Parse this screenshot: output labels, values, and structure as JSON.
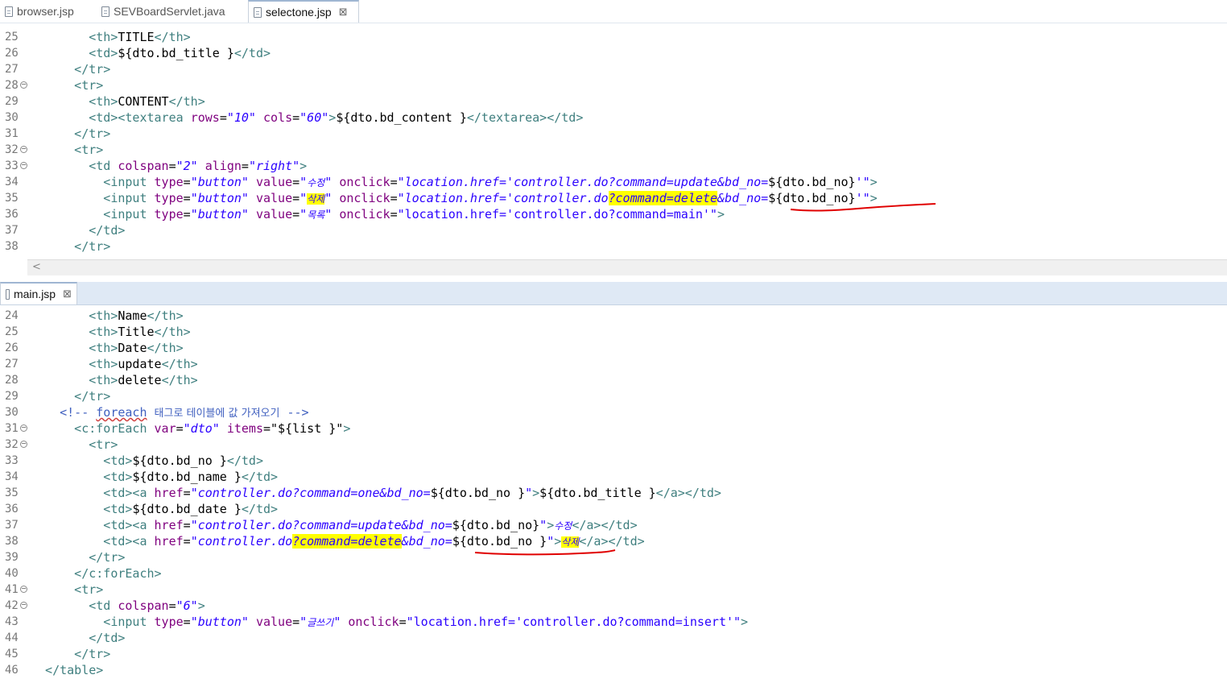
{
  "top_tabs": [
    {
      "label": "browser.jsp"
    },
    {
      "label": "SEVBoardServlet.java"
    },
    {
      "label": "selectone.jsp",
      "active": true
    }
  ],
  "bottom_tabs": [
    {
      "label": "main.jsp",
      "active": true
    }
  ],
  "close_glyph": "⊠",
  "scroll_left_glyph": "<",
  "colors": {
    "highlight": "#ffff00",
    "annotation": "#e00000",
    "tag": "#3f7f7f",
    "attr_name": "#7f007f",
    "attr_value": "#2a00ff"
  },
  "editor1": {
    "lines": [
      {
        "n": "25",
        "s": [
          [
            "tg",
            "        <th>"
          ],
          [
            "tx",
            "TITLE"
          ],
          [
            "tg",
            "</th>"
          ]
        ]
      },
      {
        "n": "26",
        "s": [
          [
            "tg",
            "        <td>"
          ],
          [
            "tx",
            "${dto.bd_title }"
          ],
          [
            "tg",
            "</td>"
          ]
        ]
      },
      {
        "n": "27",
        "s": [
          [
            "tg",
            "      </tr>"
          ]
        ]
      },
      {
        "n": "28",
        "fold": true,
        "s": [
          [
            "tg",
            "      <tr>"
          ]
        ]
      },
      {
        "n": "29",
        "s": [
          [
            "tg",
            "        <th>"
          ],
          [
            "tx",
            "CONTENT"
          ],
          [
            "tg",
            "</th>"
          ]
        ]
      },
      {
        "n": "30",
        "s": [
          [
            "tg",
            "        <td><textarea "
          ],
          [
            "an",
            "rows"
          ],
          [
            "tx",
            "="
          ],
          [
            "av",
            "\"10\""
          ],
          [
            "tx",
            " "
          ],
          [
            "an",
            "cols"
          ],
          [
            "tx",
            "="
          ],
          [
            "av",
            "\"60\""
          ],
          [
            "tg",
            ">"
          ],
          [
            "tx",
            "${dto.bd_content }"
          ],
          [
            "tg",
            "</textarea></td>"
          ]
        ]
      },
      {
        "n": "31",
        "s": [
          [
            "tg",
            "      </tr>"
          ]
        ]
      },
      {
        "n": "32",
        "fold": true,
        "s": [
          [
            "tg",
            "      <tr>"
          ]
        ]
      },
      {
        "n": "33",
        "fold": true,
        "s": [
          [
            "tg",
            "        <td "
          ],
          [
            "an",
            "colspan"
          ],
          [
            "tx",
            "="
          ],
          [
            "av",
            "\"2\""
          ],
          [
            "tx",
            " "
          ],
          [
            "an",
            "align"
          ],
          [
            "tx",
            "="
          ],
          [
            "av",
            "\"right\""
          ],
          [
            "tg",
            ">"
          ]
        ]
      },
      {
        "n": "34",
        "s": [
          [
            "tg",
            "          <input "
          ],
          [
            "an",
            "type"
          ],
          [
            "tx",
            "="
          ],
          [
            "av",
            "\"button\""
          ],
          [
            "tx",
            " "
          ],
          [
            "an",
            "value"
          ],
          [
            "tx",
            "="
          ],
          [
            "av",
            "\""
          ],
          [
            "ko",
            "수정"
          ],
          [
            "av",
            "\""
          ],
          [
            "tx",
            " "
          ],
          [
            "an",
            "onclick"
          ],
          [
            "tx",
            "="
          ],
          [
            "av",
            "\"location.href='controller.do?command=update&bd_no="
          ],
          [
            "tx",
            "${dto.bd_no}"
          ],
          [
            "av",
            "'\""
          ],
          [
            "tg",
            ">"
          ]
        ]
      },
      {
        "n": "35",
        "s": [
          [
            "tg",
            "          <input "
          ],
          [
            "an",
            "type"
          ],
          [
            "tx",
            "="
          ],
          [
            "av",
            "\"button\""
          ],
          [
            "tx",
            " "
          ],
          [
            "an",
            "value"
          ],
          [
            "tx",
            "="
          ],
          [
            "av",
            "\""
          ],
          [
            "kohl",
            "삭제"
          ],
          [
            "av",
            "\""
          ],
          [
            "tx",
            " "
          ],
          [
            "an",
            "onclick"
          ],
          [
            "tx",
            "="
          ],
          [
            "av",
            "\"location.href='controller.do"
          ],
          [
            "avhl",
            "?command=delet"
          ],
          [
            "avhl2",
            "e"
          ],
          [
            "av",
            "&bd_no="
          ],
          [
            "tx",
            "${dto.bd_no}"
          ],
          [
            "av",
            "'\""
          ],
          [
            "tg",
            ">"
          ]
        ]
      },
      {
        "n": "36",
        "s": [
          [
            "tg",
            "          <input "
          ],
          [
            "an",
            "type"
          ],
          [
            "tx",
            "="
          ],
          [
            "av",
            "\"button\""
          ],
          [
            "tx",
            " "
          ],
          [
            "an",
            "value"
          ],
          [
            "tx",
            "="
          ],
          [
            "av",
            "\""
          ],
          [
            "ko",
            "목록"
          ],
          [
            "av",
            "\""
          ],
          [
            "tx",
            " "
          ],
          [
            "an",
            "onclick"
          ],
          [
            "tx",
            "="
          ],
          [
            "avn",
            "\"location.href='controller.do?command=main'\""
          ],
          [
            "tg",
            ">"
          ]
        ]
      },
      {
        "n": "37",
        "s": [
          [
            "tg",
            "        </td>"
          ]
        ]
      },
      {
        "n": "38",
        "s": [
          [
            "tg",
            "      </tr>"
          ]
        ]
      }
    ]
  },
  "editor2": {
    "lines": [
      {
        "n": "24",
        "s": [
          [
            "tg",
            "        <th>"
          ],
          [
            "tx",
            "Name"
          ],
          [
            "tg",
            "</th>"
          ]
        ]
      },
      {
        "n": "25",
        "s": [
          [
            "tg",
            "        <th>"
          ],
          [
            "tx",
            "Title"
          ],
          [
            "tg",
            "</th>"
          ]
        ]
      },
      {
        "n": "26",
        "s": [
          [
            "tg",
            "        <th>"
          ],
          [
            "tx",
            "Date"
          ],
          [
            "tg",
            "</th>"
          ]
        ]
      },
      {
        "n": "27",
        "s": [
          [
            "tg",
            "        <th>"
          ],
          [
            "tx",
            "update"
          ],
          [
            "tg",
            "</th>"
          ]
        ]
      },
      {
        "n": "28",
        "s": [
          [
            "tg",
            "        <th>"
          ],
          [
            "tx",
            "delete"
          ],
          [
            "tg",
            "</th>"
          ]
        ]
      },
      {
        "n": "29",
        "s": [
          [
            "tg",
            "      </tr>"
          ]
        ]
      },
      {
        "n": "30",
        "s": [
          [
            "cm",
            "    <!-- "
          ],
          [
            "cmsq",
            "foreach"
          ],
          [
            "cm",
            " "
          ],
          [
            "cmk",
            "태그로 테이블에 값 가져오기"
          ],
          [
            "cm",
            " -->"
          ]
        ]
      },
      {
        "n": "31",
        "fold": true,
        "s": [
          [
            "tg",
            "      <c:forEach "
          ],
          [
            "an",
            "var"
          ],
          [
            "tx",
            "="
          ],
          [
            "av",
            "\"dto\""
          ],
          [
            "tx",
            " "
          ],
          [
            "an",
            "items"
          ],
          [
            "tx",
            "="
          ],
          [
            "tx",
            "\"${list }\""
          ],
          [
            "tg",
            ">"
          ]
        ]
      },
      {
        "n": "32",
        "fold": true,
        "s": [
          [
            "tg",
            "        <tr>"
          ]
        ]
      },
      {
        "n": "33",
        "s": [
          [
            "tg",
            "          <td>"
          ],
          [
            "tx",
            "${dto.bd_no }"
          ],
          [
            "tg",
            "</td>"
          ]
        ]
      },
      {
        "n": "34",
        "s": [
          [
            "tg",
            "          <td>"
          ],
          [
            "tx",
            "${dto.bd_name }"
          ],
          [
            "tg",
            "</td>"
          ]
        ]
      },
      {
        "n": "35",
        "s": [
          [
            "tg",
            "          <td><a "
          ],
          [
            "an",
            "href"
          ],
          [
            "tx",
            "="
          ],
          [
            "av",
            "\"controller.do?command=one&bd_no="
          ],
          [
            "tx",
            "${dto.bd_no }"
          ],
          [
            "av",
            "\""
          ],
          [
            "tg",
            ">"
          ],
          [
            "tx",
            "${dto.bd_title }"
          ],
          [
            "tg",
            "</a></td>"
          ]
        ]
      },
      {
        "n": "36",
        "s": [
          [
            "tg",
            "          <td>"
          ],
          [
            "tx",
            "${dto.bd_date }"
          ],
          [
            "tg",
            "</td>"
          ]
        ]
      },
      {
        "n": "37",
        "s": [
          [
            "tg",
            "          <td><a "
          ],
          [
            "an",
            "href"
          ],
          [
            "tx",
            "="
          ],
          [
            "av",
            "\"controller.do?command=update&bd_no="
          ],
          [
            "tx",
            "${dto.bd_no}"
          ],
          [
            "av",
            "\""
          ],
          [
            "tg",
            ">"
          ],
          [
            "ko",
            "수정"
          ],
          [
            "tg",
            "</a></td>"
          ]
        ]
      },
      {
        "n": "38",
        "s": [
          [
            "tg",
            "          <td><a "
          ],
          [
            "an",
            "href"
          ],
          [
            "tx",
            "="
          ],
          [
            "av",
            "\"controller.do"
          ],
          [
            "avhl",
            "?command=delete"
          ],
          [
            "av",
            "&bd_no="
          ],
          [
            "tx",
            "${dto.bd_no }"
          ],
          [
            "av",
            "\""
          ],
          [
            "tg",
            ">"
          ],
          [
            "kohl",
            "삭제"
          ],
          [
            "tg",
            "</a></td>"
          ]
        ]
      },
      {
        "n": "39",
        "s": [
          [
            "tg",
            "        </tr>"
          ]
        ]
      },
      {
        "n": "40",
        "s": [
          [
            "tg",
            "      </c:forEach>"
          ]
        ]
      },
      {
        "n": "41",
        "fold": true,
        "s": [
          [
            "tg",
            "      <tr>"
          ]
        ]
      },
      {
        "n": "42",
        "fold": true,
        "s": [
          [
            "tg",
            "        <td "
          ],
          [
            "an",
            "colspan"
          ],
          [
            "tx",
            "="
          ],
          [
            "av",
            "\"6\""
          ],
          [
            "tg",
            ">"
          ]
        ]
      },
      {
        "n": "43",
        "s": [
          [
            "tg",
            "          <input "
          ],
          [
            "an",
            "type"
          ],
          [
            "tx",
            "="
          ],
          [
            "av",
            "\"button\""
          ],
          [
            "tx",
            " "
          ],
          [
            "an",
            "value"
          ],
          [
            "tx",
            "="
          ],
          [
            "av",
            "\""
          ],
          [
            "ko",
            "글쓰기"
          ],
          [
            "av",
            "\""
          ],
          [
            "tx",
            " "
          ],
          [
            "an",
            "onclick"
          ],
          [
            "tx",
            "="
          ],
          [
            "avn",
            "\"location.href='controller.do?command=insert'\""
          ],
          [
            "tg",
            ">"
          ]
        ]
      },
      {
        "n": "44",
        "s": [
          [
            "tg",
            "        </td>"
          ]
        ]
      },
      {
        "n": "45",
        "s": [
          [
            "tg",
            "      </tr>"
          ]
        ]
      },
      {
        "n": "46",
        "s": [
          [
            "tg",
            "  </table>"
          ]
        ]
      }
    ]
  }
}
